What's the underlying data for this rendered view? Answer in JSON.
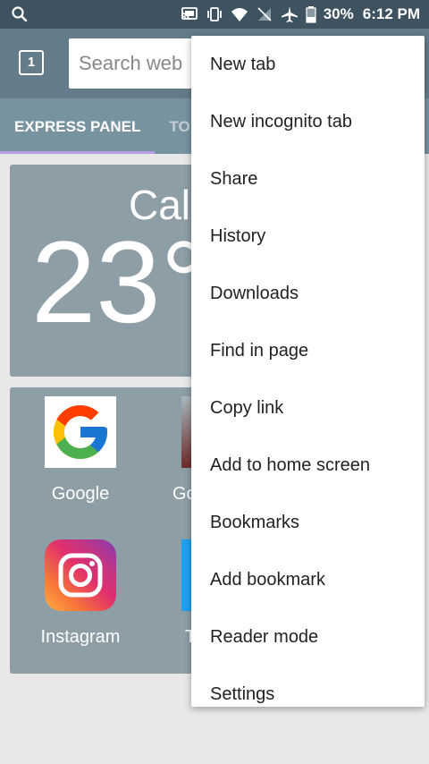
{
  "statusbar": {
    "battery": "30%",
    "time": "6:12 PM"
  },
  "toolbar": {
    "tab_count": "1",
    "search_placeholder": "Search web"
  },
  "tabs": {
    "express_panel": "EXPRESS PANEL",
    "second_tab_partial": "TO"
  },
  "weather": {
    "city_partial": "Cali",
    "temp_partial": "23°"
  },
  "speed_dial": [
    {
      "label": "Google"
    },
    {
      "label": "Go"
    },
    {
      "label": "Instagram"
    },
    {
      "label": "T"
    }
  ],
  "menu": {
    "items": [
      {
        "label": "New tab"
      },
      {
        "label": "New incognito tab"
      },
      {
        "label": "Share"
      },
      {
        "label": "History"
      },
      {
        "label": "Downloads"
      },
      {
        "label": "Find in page"
      },
      {
        "label": "Copy link"
      },
      {
        "label": "Add to home screen"
      },
      {
        "label": "Bookmarks"
      },
      {
        "label": "Add bookmark"
      },
      {
        "label": "Reader mode"
      },
      {
        "label": "Settings"
      }
    ]
  },
  "colors": {
    "statusbar": "#3e535f",
    "toolbar": "#647c89",
    "tabs": "#7893a0",
    "accent_indicator": "#b79fe6",
    "card": "#8d9ea7"
  }
}
